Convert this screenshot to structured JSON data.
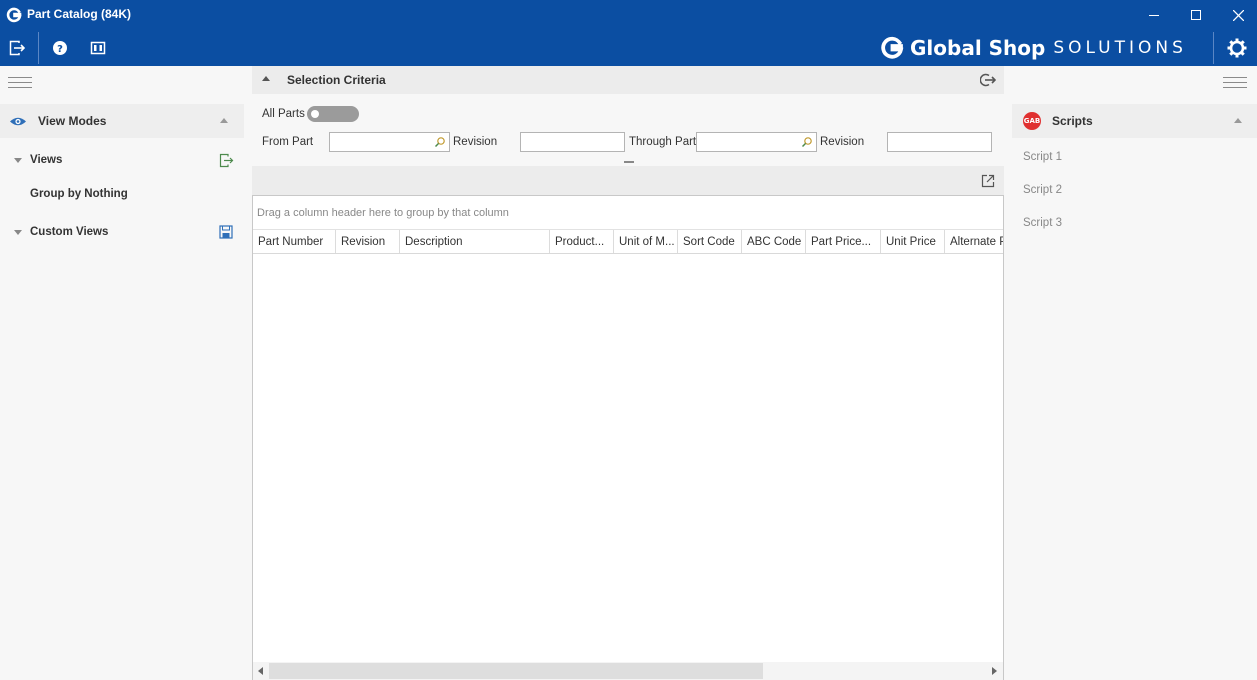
{
  "window": {
    "title": "Part Catalog (84K)",
    "minimize": "—",
    "maximize": "☐",
    "close": "✕"
  },
  "toolbar": {
    "icons": [
      "exit-icon",
      "help-icon",
      "layout-icon"
    ]
  },
  "brand": {
    "main": "Global Shop",
    "sub": "SOLUTIONS"
  },
  "left_panel": {
    "section_title": "View Modes",
    "views_label": "Views",
    "group_by_label": "Group by Nothing",
    "custom_views_label": "Custom Views"
  },
  "selection": {
    "title": "Selection Criteria",
    "all_parts_label": "All Parts",
    "all_parts_on": false,
    "from_part_label": "From Part",
    "revision_label_1": "Revision",
    "through_part_label": "Through Part",
    "revision_label_2": "Revision",
    "from_part_value": "",
    "revision_1_value": "",
    "through_part_value": "",
    "revision_2_value": ""
  },
  "grid": {
    "group_hint": "Drag a column header here to group by that column",
    "columns": [
      "Part Number",
      "Revision",
      "Description",
      "Product...",
      "Unit of M...",
      "Sort Code",
      "ABC Code",
      "Part Price...",
      "Unit Price",
      "Alternate P"
    ]
  },
  "right_panel": {
    "section_title": "Scripts",
    "badge": "GAB",
    "scripts": [
      "Script 1",
      "Script 2",
      "Script 3"
    ]
  },
  "colors": {
    "title_bar": "#0b4ea2",
    "accent_blue": "#2f6fb8",
    "script_badge": "#e03030"
  }
}
